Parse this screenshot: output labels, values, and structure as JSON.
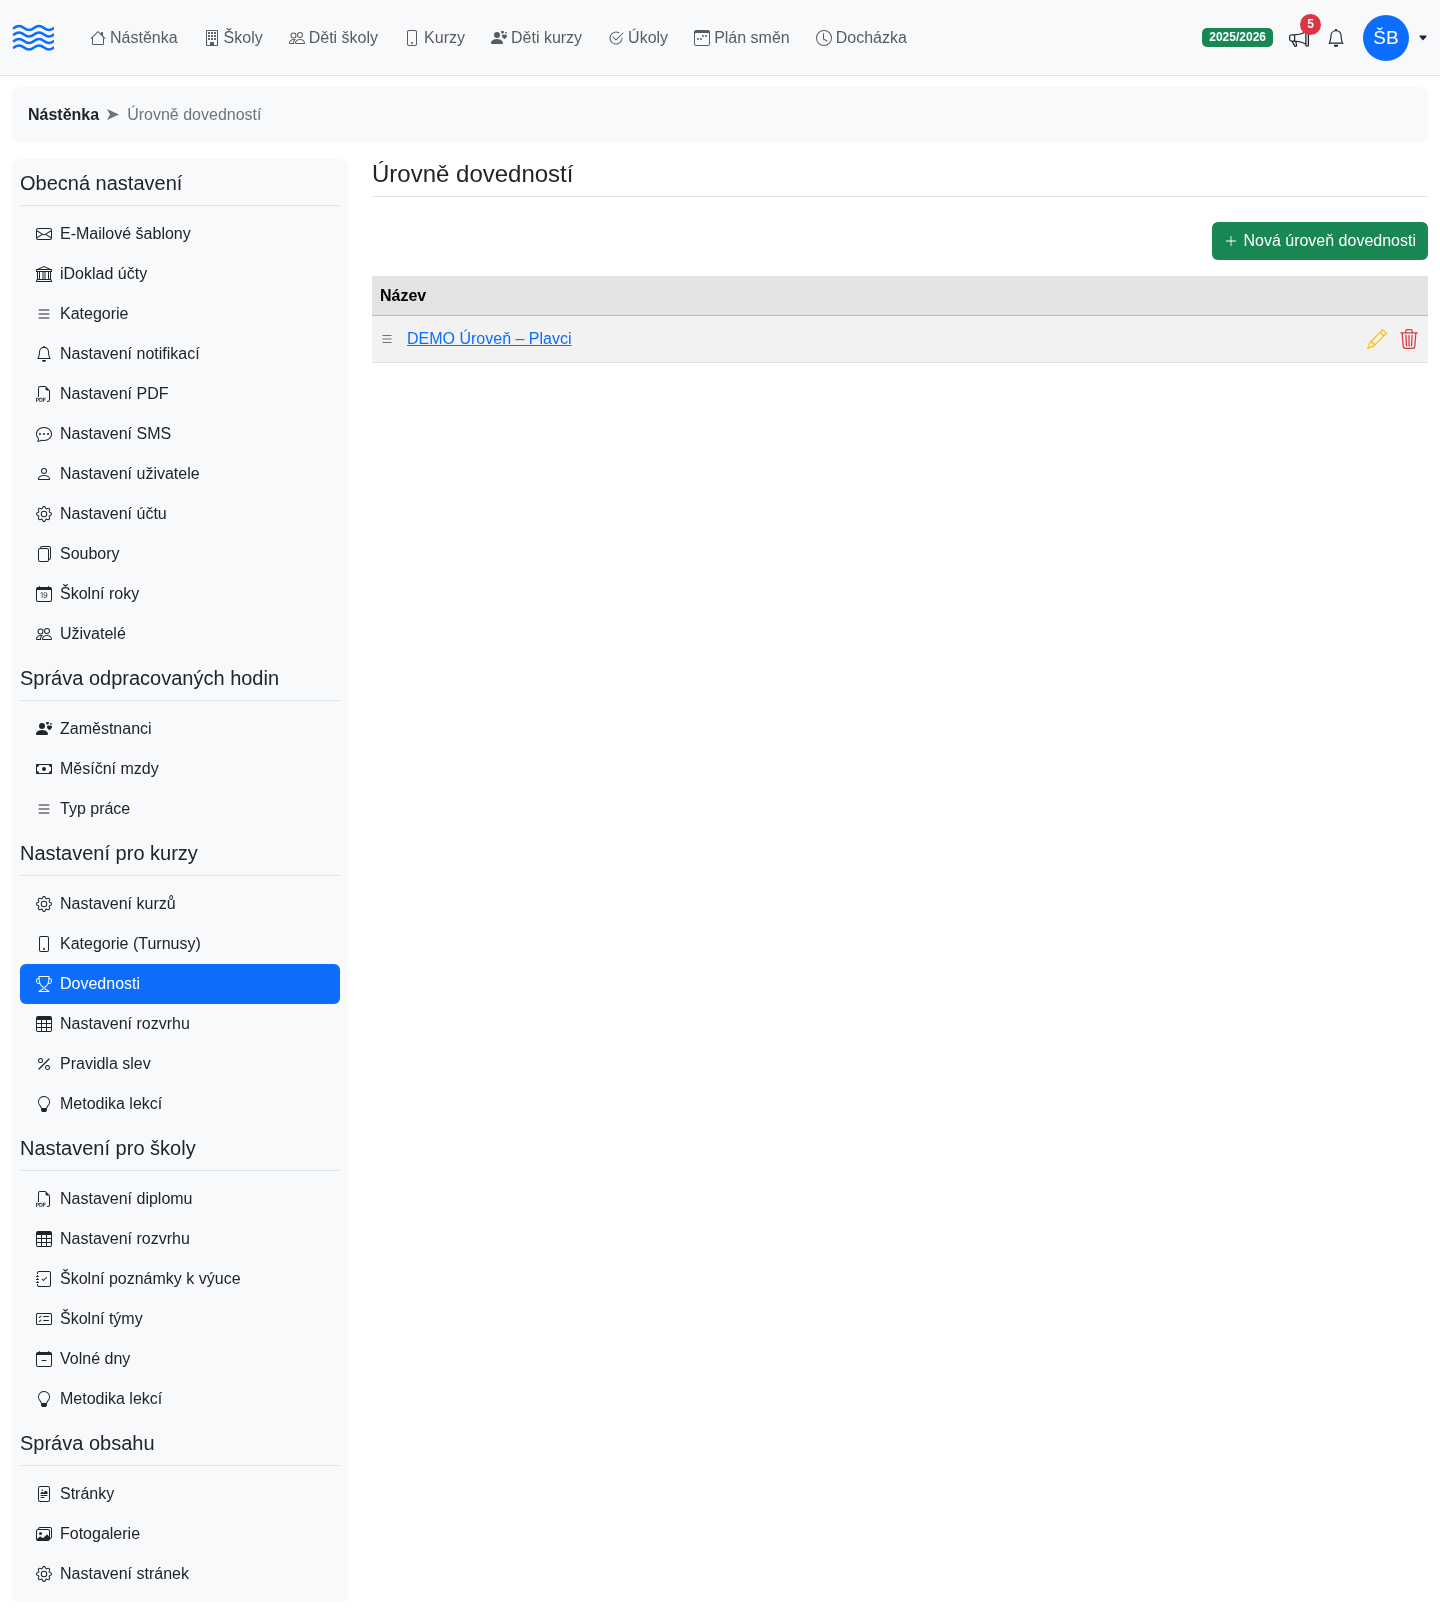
{
  "nav": {
    "menu": [
      {
        "label": "Nástěnka"
      },
      {
        "label": "Školy"
      },
      {
        "label": "Děti školy"
      },
      {
        "label": "Kurzy"
      },
      {
        "label": "Děti kurzy"
      },
      {
        "label": "Úkoly"
      },
      {
        "label": "Plán směn"
      },
      {
        "label": "Docházka"
      }
    ],
    "school_year": "2025/2026",
    "announcement_count": "5",
    "avatar_initials": "ŠB"
  },
  "breadcrumb": [
    {
      "label": "Nástěnka",
      "kind": "link"
    },
    {
      "label": "Úrovně dovedností",
      "kind": "current"
    }
  ],
  "sidebar": {
    "sections": [
      {
        "title": "Obecná nastavení",
        "items": [
          {
            "label": "E-Mailové šablony",
            "selected": false
          },
          {
            "label": "iDoklad účty",
            "selected": false
          },
          {
            "label": "Kategorie",
            "selected": false
          },
          {
            "label": "Nastavení notifikací",
            "selected": false
          },
          {
            "label": "Nastavení PDF",
            "selected": false
          },
          {
            "label": "Nastavení SMS",
            "selected": false
          },
          {
            "label": "Nastavení uživatele",
            "selected": false
          },
          {
            "label": "Nastavení účtu",
            "selected": false
          },
          {
            "label": "Soubory",
            "selected": false
          },
          {
            "label": "Školní roky",
            "selected": false
          },
          {
            "label": "Uživatelé",
            "selected": false
          }
        ]
      },
      {
        "title": "Správa odpracovaných hodin",
        "items": [
          {
            "label": "Zaměstnanci",
            "selected": false
          },
          {
            "label": "Měsíční mzdy",
            "selected": false
          },
          {
            "label": "Typ práce",
            "selected": false
          }
        ]
      },
      {
        "title": "Nastavení pro kurzy",
        "items": [
          {
            "label": "Nastavení kurzů",
            "selected": false
          },
          {
            "label": "Kategorie (Turnusy)",
            "selected": false
          },
          {
            "label": "Dovednosti",
            "selected": true
          },
          {
            "label": "Nastavení rozvrhu",
            "selected": false
          },
          {
            "label": "Pravidla slev",
            "selected": false
          },
          {
            "label": "Metodika lekcí",
            "selected": false
          }
        ]
      },
      {
        "title": "Nastavení pro školy",
        "items": [
          {
            "label": "Nastavení diplomu",
            "selected": false
          },
          {
            "label": "Nastavení rozvrhu",
            "selected": false
          },
          {
            "label": "Školní poznámky k výuce",
            "selected": false
          },
          {
            "label": "Školní týmy",
            "selected": false
          },
          {
            "label": "Volné dny",
            "selected": false
          },
          {
            "label": "Metodika lekcí",
            "selected": false
          }
        ]
      },
      {
        "title": "Správa obsahu",
        "items": [
          {
            "label": "Stránky",
            "selected": false
          },
          {
            "label": "Fotogalerie",
            "selected": false
          },
          {
            "label": "Nastavení stránek",
            "selected": false
          }
        ]
      }
    ]
  },
  "page": {
    "title": "Úrovně dovedností",
    "new_button": "Nová úroveň dovednosti",
    "table": {
      "columns": [
        "Název"
      ],
      "rows": [
        {
          "name": "DEMO Úroveň – Plavci"
        }
      ]
    }
  }
}
